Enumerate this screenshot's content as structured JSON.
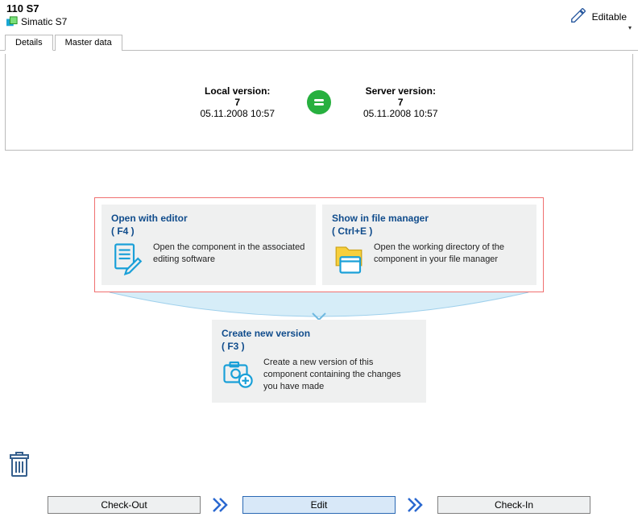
{
  "header": {
    "title": "110 S7",
    "subtitle": "Simatic S7",
    "editable_label": "Editable"
  },
  "tabs": [
    {
      "label": "Details",
      "active": true
    },
    {
      "label": "Master data",
      "active": false
    }
  ],
  "compare": {
    "local_label": "Local version:",
    "local_version": "7",
    "local_time": "05.11.2008 10:57",
    "server_label": "Server version:",
    "server_version": "7",
    "server_time": "05.11.2008 10:57"
  },
  "cards": {
    "open_editor": {
      "title": "Open with editor",
      "shortcut": "( F4 )",
      "desc": "Open the component in the associated editing software"
    },
    "show_fm": {
      "title": "Show in file manager",
      "shortcut": "( Ctrl+E )",
      "desc": "Open the working directory of the component in your file manager"
    },
    "new_version": {
      "title": "Create new version",
      "shortcut": "( F3 )",
      "desc": "Create a new version of this component containing the changes you have made"
    }
  },
  "footer": {
    "checkout": "Check-Out",
    "edit": "Edit",
    "checkin": "Check-In"
  }
}
